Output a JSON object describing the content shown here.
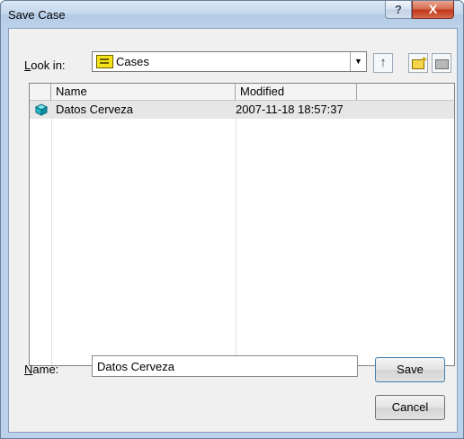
{
  "window": {
    "title": "Save Case",
    "help_glyph": "?",
    "close_glyph": "X"
  },
  "lookin": {
    "label_u": "L",
    "label_rest": "ook in:",
    "value": "Cases",
    "icon": "case-folder-icon"
  },
  "toolbar": {
    "up_glyph": "↑",
    "icons": [
      "up-one-level-icon",
      "new-folder-icon",
      "view-menu-icon"
    ]
  },
  "list": {
    "columns": [
      "Name",
      "Modified"
    ],
    "rows": [
      {
        "name": "Datos Cerveza",
        "modified": "2007-11-18 18:57:37",
        "icon": "case-box-icon"
      }
    ]
  },
  "name_field": {
    "label_u": "N",
    "label_rest": "ame:",
    "value": "Datos Cerveza"
  },
  "buttons": {
    "save": "Save",
    "cancel": "Cancel"
  },
  "colors": {
    "frame": "#b9d1ea",
    "close": "#c2381b",
    "selection": "#e6e6e6"
  }
}
